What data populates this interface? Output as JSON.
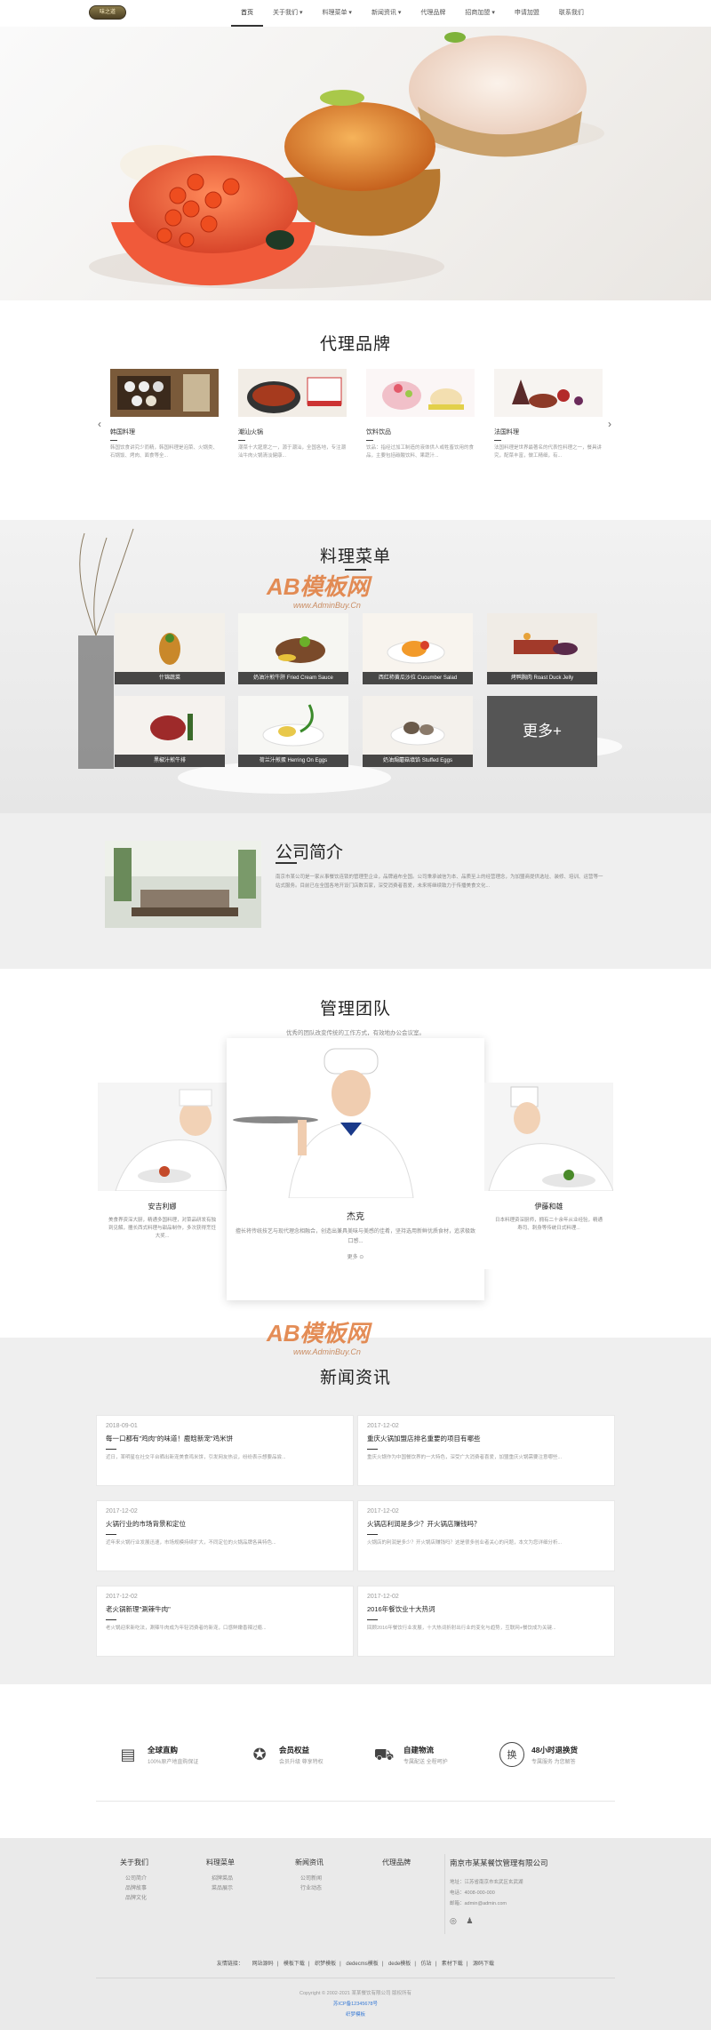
{
  "header": {
    "logo_text": "味之道",
    "nav": [
      "首页",
      "关于我们 ▾",
      "料理菜单 ▾",
      "新闻资讯 ▾",
      "代理品牌",
      "招商加盟 ▾",
      "申请加盟",
      "联系我们"
    ]
  },
  "brands": {
    "title": "代理品牌",
    "items": [
      {
        "name": "韩国料理",
        "desc": "韩国饮食讲究少而精，韩国料理是泡菜、火锅类、石锅饭、烤肉、面食等全..."
      },
      {
        "name": "潮汕火锅",
        "desc": "潮菜十大筵席之一，源于潮汕，全国各地，专注潮汕牛肉火锅清淡健康..."
      },
      {
        "name": "饮料饮品",
        "desc": "饮品：指经过加工制造的液体供人或牲畜饮用的食品，主要包括碳酸饮料、果蔬汁..."
      },
      {
        "name": "法国料理",
        "desc": "法国料理是世界最著名的代表性料理之一，餐具讲究，配菜丰富，做工精细，有..."
      }
    ]
  },
  "menu": {
    "title": "料理菜单",
    "dishes": [
      "什锦蔬菜",
      "奶油汁煎牛肝 Fried Cream Sauce",
      "西红柿黄瓜沙拉 Cucumber Salad",
      "烤鸭胸肉 Roast Duck Jelly",
      "黑椒汁煎牛排",
      "荷兰汁煎蛋 Herring On Eggs",
      "奶油焗蘑菇填馅 Stuffed Eggs"
    ],
    "more_label": "更多+"
  },
  "company": {
    "title": "公司简介",
    "text": "南京市某公司是一家从事餐饮连锁的管理型企业，品牌遍布全国。公司秉承诚信为本、品质至上的经营理念，为加盟商提供选址、装修、培训、运营等一站式服务。目前已在全国各地开设门店数百家，深受消费者喜爱，未来将继续致力于传播美食文化..."
  },
  "team": {
    "title": "管理团队",
    "subtitle": "优秀的团队改变传统的工作方式，有效地办公会议室。",
    "members": [
      {
        "name": "安吉利娜",
        "desc": "美食界资深大厨，精通多国料理，对菜品研发有独到见解，擅长西式料理与甜品制作，多次获得烹饪大奖..."
      },
      {
        "name": "杰克",
        "desc": "擅长将传统技艺与现代理念相融合，创造出兼具美味与美感的佳肴，坚持选用新鲜优质食材，追求极致口感...",
        "more": "更多 ⊙"
      },
      {
        "name": "伊藤和雄",
        "desc": "日本料理资深厨师，拥有二十余年从业经验，精通寿司、刺身等传统日式料理..."
      }
    ]
  },
  "watermark": {
    "brand": "AB模板网",
    "url": "www.AdminBuy.Cn"
  },
  "news": {
    "title": "新闻资讯",
    "items": [
      {
        "date": "2018-09-01",
        "title": "每一口都有\"鸡肉\"的味道！鹿晗新宠\"鸡米饼",
        "desc": "近日，某明星在社交平台晒出新宠美食鸡米饼，引发网友热议，纷纷表示想要品尝..."
      },
      {
        "date": "2017-12-02",
        "title": "重庆火锅加盟店排名重要的项目有哪些",
        "desc": "重庆火锅作为中国餐饮界的一大特色，深受广大消费者喜爱，加盟重庆火锅需要注意哪些..."
      },
      {
        "date": "2017-12-02",
        "title": "火锅行业的市场背景和定位",
        "desc": "近年来火锅行业发展迅速，市场规模持续扩大，不同定位的火锅品牌各具特色..."
      },
      {
        "date": "2017-12-02",
        "title": "火锅店利润是多少？开火锅店赚钱吗？",
        "desc": "火锅店的利润是多少？开火锅店赚钱吗？这是很多创业者关心的问题，本文为您详细分析..."
      },
      {
        "date": "2017-12-02",
        "title": "老火锅新理\"涮辣牛肉\"",
        "desc": "老火锅迎来新吃法，涮辣牛肉成为年轻消费者的新宠，口感鲜嫩香辣过瘾..."
      },
      {
        "date": "2017-12-02",
        "title": "2016年餐饮业十大热词",
        "desc": "回顾2016年餐饮行业发展，十大热词折射出行业的变化与趋势，互联网+餐饮成为关键..."
      }
    ]
  },
  "services": [
    {
      "icon": "receipt-icon",
      "glyph": "▤",
      "title": "全球直购",
      "desc": "100%原产地直购保证"
    },
    {
      "icon": "badge-icon",
      "glyph": "✪",
      "title": "会员权益",
      "desc": "会员升级 尊享特权"
    },
    {
      "icon": "truck-icon",
      "glyph": "⛟",
      "title": "自建物流",
      "desc": "专属配送 全程呵护"
    },
    {
      "icon": "exchange-icon",
      "glyph": "换",
      "title": "48小时退换货",
      "desc": "专属服务 为您解答"
    }
  ],
  "footer": {
    "cols": [
      {
        "h": "关于我们",
        "items": [
          "公司简介",
          "品牌故事",
          "品牌文化"
        ]
      },
      {
        "h": "料理菜单",
        "items": [
          "招牌菜品",
          "菜品展示"
        ]
      },
      {
        "h": "新闻资讯",
        "items": [
          "公司新闻",
          "行业动态"
        ]
      },
      {
        "h": "代理品牌",
        "items": []
      }
    ],
    "company": "南京市某某餐饮管理有限公司",
    "addr": "地址：江苏省南京市玄武区玄武湖",
    "tel": "电话：4008-000-000",
    "mail": "邮箱：admin@admin.com",
    "links_label": "友情链接：",
    "links": [
      "网站源码",
      "模板下载",
      "织梦模板",
      "dedecms模板",
      "dede模板",
      "仿站",
      "素材下载",
      "源码下载"
    ],
    "copyright": "Copyright © 2002-2021 某某餐饮有限公司 版权所有",
    "icp": "苏ICP备12345678号",
    "credit": "织梦模板"
  }
}
